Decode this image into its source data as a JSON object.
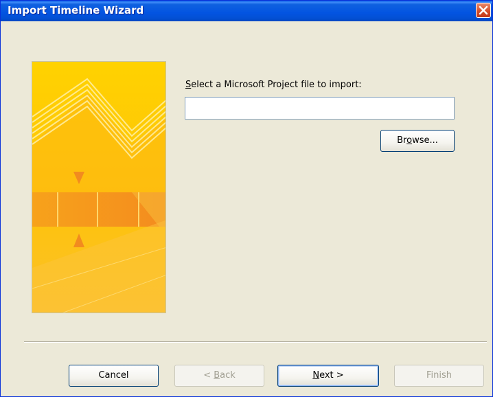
{
  "window": {
    "title": "Import Timeline Wizard"
  },
  "prompt": {
    "pre": "",
    "accel": "S",
    "post": "elect a Microsoft Project file to import:"
  },
  "file_input": {
    "value": ""
  },
  "buttons": {
    "browse": {
      "pre": "Br",
      "accel": "o",
      "post": "wse..."
    },
    "cancel": {
      "label": "Cancel"
    },
    "back": {
      "pre": "< ",
      "accel": "B",
      "post": "ack"
    },
    "next": {
      "pre": "",
      "accel": "N",
      "post": "ext >"
    },
    "finish": {
      "label": "Finish"
    }
  },
  "colors": {
    "titlebar": "#0354e1",
    "dialog_bg": "#ece9d8",
    "banner": "#fec30a",
    "close": "#d34a26"
  }
}
